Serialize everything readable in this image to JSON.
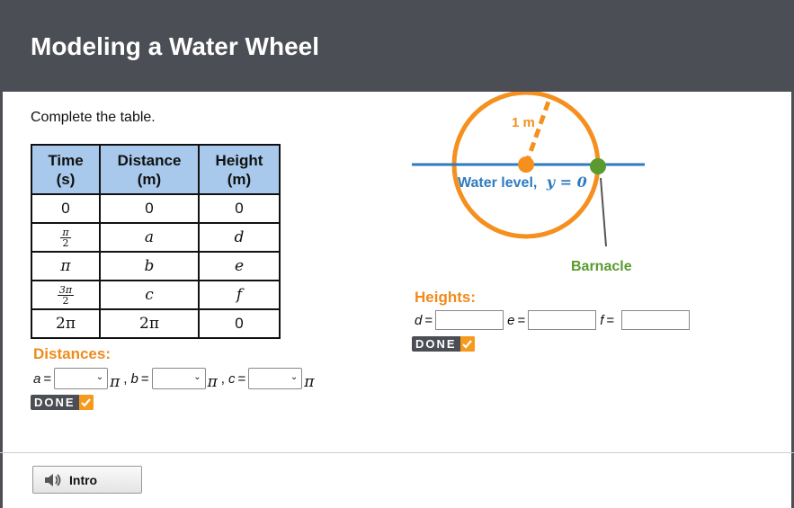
{
  "header": {
    "title": "Modeling a Water Wheel"
  },
  "instruction": "Complete the table.",
  "table": {
    "headers": [
      {
        "line1": "Time",
        "line2": "(s)"
      },
      {
        "line1": "Distance",
        "line2": "(m)"
      },
      {
        "line1": "Height",
        "line2": "(m)"
      }
    ],
    "rows": [
      {
        "time": "0",
        "distance": "0",
        "height": "0"
      },
      {
        "time_num": "π",
        "time_den": "2",
        "distance": "a",
        "height": "d"
      },
      {
        "time": "π",
        "distance": "b",
        "height": "e"
      },
      {
        "time_num": "3π",
        "time_den": "2",
        "distance": "c",
        "height": "f"
      },
      {
        "time": "2π",
        "distance": "2π",
        "height": "0"
      }
    ]
  },
  "distances": {
    "label": "Distances:",
    "a_var": "a",
    "b_var": "b",
    "c_var": "c",
    "eq": "=",
    "pi": "π",
    "comma": ",",
    "a_value": "",
    "b_value": "",
    "c_value": ""
  },
  "heights": {
    "label": "Heights:",
    "d_var": "d",
    "e_var": "e",
    "f_var": "f",
    "eq": "=",
    "d_value": "",
    "e_value": "",
    "f_value": ""
  },
  "done_label": "DONE",
  "diagram": {
    "radius_label": "1 m",
    "water_level_text": "Water level,",
    "water_level_eq": "y = 0",
    "barnacle_label": "Barnacle",
    "colors": {
      "wheel": "#f5901e",
      "water": "#2f7bc0",
      "barnacle": "#5a9a2f"
    }
  },
  "footer": {
    "intro_label": "Intro"
  }
}
